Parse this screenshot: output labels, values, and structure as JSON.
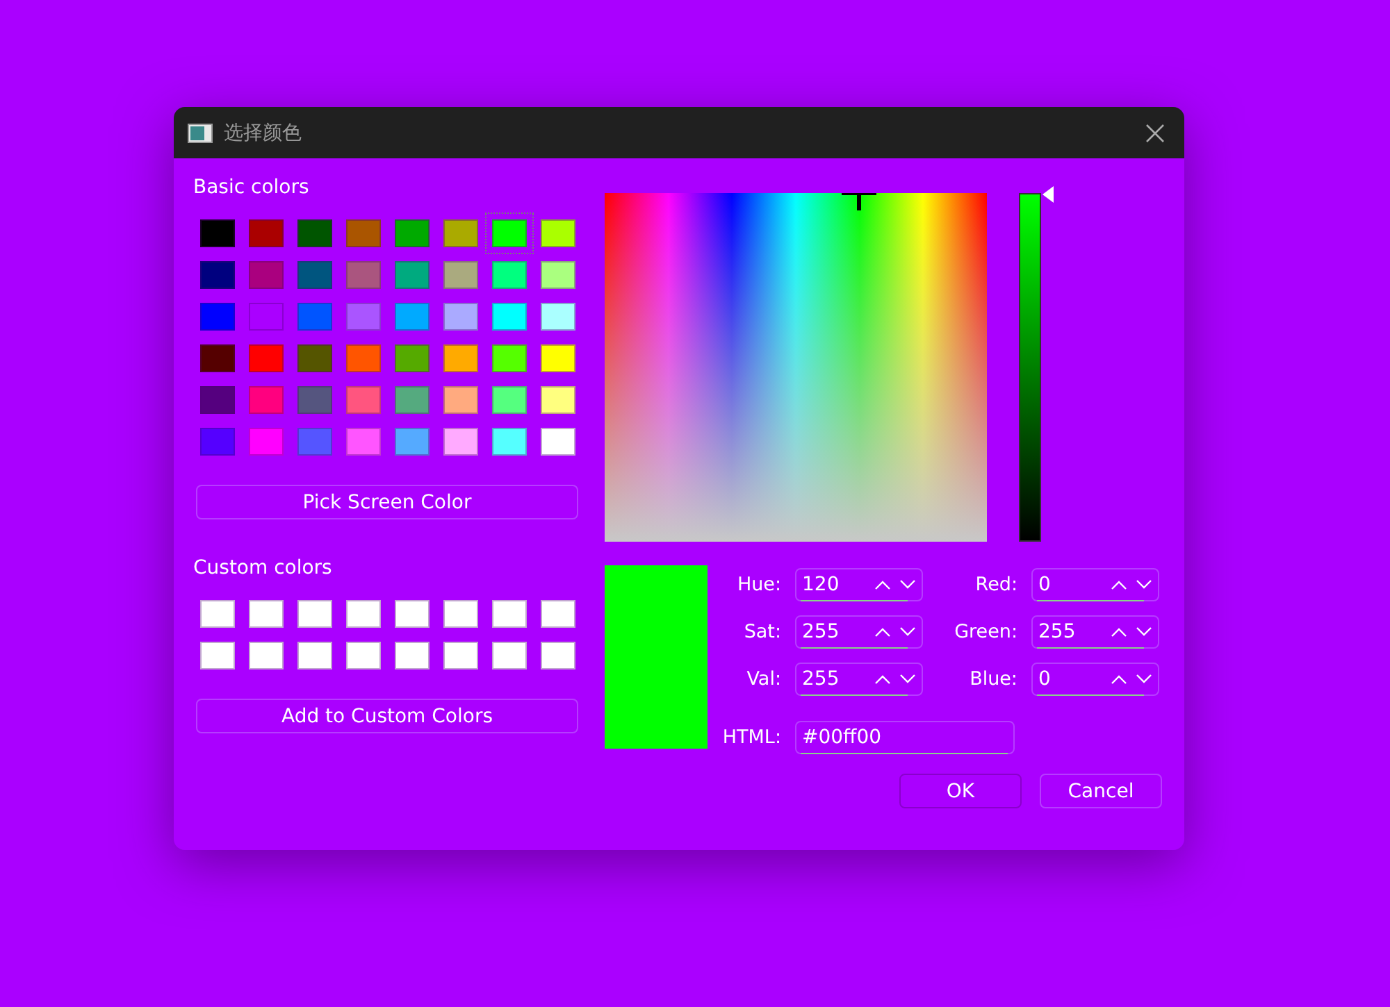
{
  "window": {
    "title": "选择颜色"
  },
  "basic_colors": {
    "label": "Basic colors",
    "swatches": [
      {
        "color": "#000000",
        "selected": false
      },
      {
        "color": "#aa0000",
        "selected": false
      },
      {
        "color": "#005500",
        "selected": false
      },
      {
        "color": "#aa5500",
        "selected": false
      },
      {
        "color": "#00aa00",
        "selected": false
      },
      {
        "color": "#aaaa00",
        "selected": false
      },
      {
        "color": "#00ff00",
        "selected": true
      },
      {
        "color": "#aaff00",
        "selected": false
      },
      {
        "color": "#00007f",
        "selected": false
      },
      {
        "color": "#aa007f",
        "selected": false
      },
      {
        "color": "#00557f",
        "selected": false
      },
      {
        "color": "#aa557f",
        "selected": false
      },
      {
        "color": "#00aa7f",
        "selected": false
      },
      {
        "color": "#aaaa7f",
        "selected": false
      },
      {
        "color": "#00ff7f",
        "selected": false
      },
      {
        "color": "#aaff7f",
        "selected": false
      },
      {
        "color": "#0000ff",
        "selected": false
      },
      {
        "color": "#aa00ff",
        "selected": false
      },
      {
        "color": "#0055ff",
        "selected": false
      },
      {
        "color": "#aa55ff",
        "selected": false
      },
      {
        "color": "#00aaff",
        "selected": false
      },
      {
        "color": "#aaaaff",
        "selected": false
      },
      {
        "color": "#00ffff",
        "selected": false
      },
      {
        "color": "#aaffff",
        "selected": false
      },
      {
        "color": "#550000",
        "selected": false
      },
      {
        "color": "#ff0000",
        "selected": false
      },
      {
        "color": "#555500",
        "selected": false
      },
      {
        "color": "#ff5500",
        "selected": false
      },
      {
        "color": "#55aa00",
        "selected": false
      },
      {
        "color": "#ffaa00",
        "selected": false
      },
      {
        "color": "#55ff00",
        "selected": false
      },
      {
        "color": "#ffff00",
        "selected": false
      },
      {
        "color": "#55007f",
        "selected": false
      },
      {
        "color": "#ff007f",
        "selected": false
      },
      {
        "color": "#55557f",
        "selected": false
      },
      {
        "color": "#ff557f",
        "selected": false
      },
      {
        "color": "#55aa7f",
        "selected": false
      },
      {
        "color": "#ffaa7f",
        "selected": false
      },
      {
        "color": "#55ff7f",
        "selected": false
      },
      {
        "color": "#ffff7f",
        "selected": false
      },
      {
        "color": "#5500ff",
        "selected": false
      },
      {
        "color": "#ff00ff",
        "selected": false
      },
      {
        "color": "#5555ff",
        "selected": false
      },
      {
        "color": "#ff55ff",
        "selected": false
      },
      {
        "color": "#55aaff",
        "selected": false
      },
      {
        "color": "#ffaaff",
        "selected": false
      },
      {
        "color": "#55ffff",
        "selected": false
      },
      {
        "color": "#ffffff",
        "selected": false
      }
    ]
  },
  "pick_screen_button": "Pick Screen Color",
  "custom_colors": {
    "label": "Custom colors",
    "swatches": [
      {
        "color": "#ffffff"
      },
      {
        "color": "#ffffff"
      },
      {
        "color": "#ffffff"
      },
      {
        "color": "#ffffff"
      },
      {
        "color": "#ffffff"
      },
      {
        "color": "#ffffff"
      },
      {
        "color": "#ffffff"
      },
      {
        "color": "#ffffff"
      },
      {
        "color": "#ffffff"
      },
      {
        "color": "#ffffff"
      },
      {
        "color": "#ffffff"
      },
      {
        "color": "#ffffff"
      },
      {
        "color": "#ffffff"
      },
      {
        "color": "#ffffff"
      },
      {
        "color": "#ffffff"
      },
      {
        "color": "#ffffff"
      }
    ]
  },
  "add_custom_button": "Add to Custom Colors",
  "value_slider": {
    "level": 1
  },
  "fields": [
    {
      "label": "Hue:",
      "value": "120"
    },
    {
      "label": "Red:",
      "value": "0"
    },
    {
      "label": "Sat:",
      "value": "255"
    },
    {
      "label": "Green:",
      "value": "255"
    },
    {
      "label": "Val:",
      "value": "255"
    },
    {
      "label": "Blue:",
      "value": "0"
    }
  ],
  "html": {
    "label": "HTML:",
    "value": "#00ff00"
  },
  "buttons": [
    {
      "label": "OK",
      "default": true
    },
    {
      "label": "Cancel",
      "default": false
    }
  ]
}
